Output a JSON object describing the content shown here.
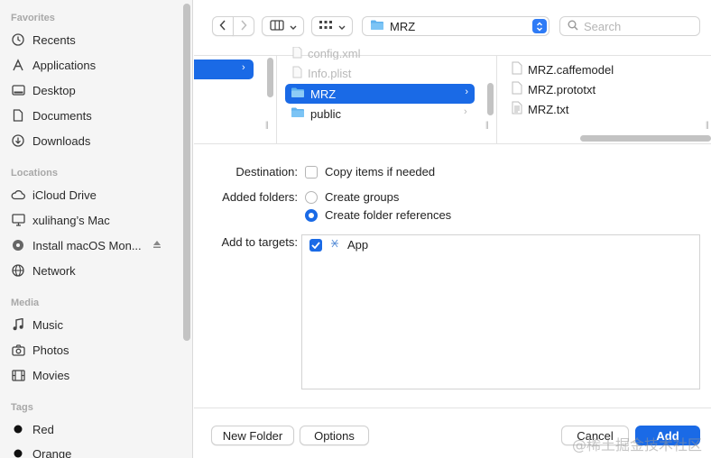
{
  "sidebar": {
    "favorites_header": "Favorites",
    "favorites": [
      {
        "label": "Recents",
        "icon": "clock-icon"
      },
      {
        "label": "Applications",
        "icon": "applications-icon"
      },
      {
        "label": "Desktop",
        "icon": "desktop-icon"
      },
      {
        "label": "Documents",
        "icon": "document-icon"
      },
      {
        "label": "Downloads",
        "icon": "download-icon"
      }
    ],
    "locations_header": "Locations",
    "locations": [
      {
        "label": "iCloud Drive",
        "icon": "cloud-icon"
      },
      {
        "label": "xulihang’s Mac",
        "icon": "computer-icon"
      },
      {
        "label": "Install macOS Mon...",
        "icon": "disk-icon"
      },
      {
        "label": "Network",
        "icon": "network-icon"
      }
    ],
    "media_header": "Media",
    "media": [
      {
        "label": "Music",
        "icon": "music-icon"
      },
      {
        "label": "Photos",
        "icon": "camera-icon"
      },
      {
        "label": "Movies",
        "icon": "film-icon"
      }
    ],
    "tags_header": "Tags",
    "tags": [
      {
        "label": "Red",
        "color": "#111111"
      },
      {
        "label": "Orange",
        "color": "#111111"
      }
    ]
  },
  "toolbar": {
    "path_value": "MRZ",
    "search_placeholder": "Search"
  },
  "browser": {
    "column2_items": [
      {
        "label": "config.xml",
        "faded": true
      },
      {
        "label": "Info.plist",
        "faded": true
      },
      {
        "label": "MRZ",
        "selected": true
      },
      {
        "label": "public"
      }
    ],
    "column3_items": [
      "MRZ.caffemodel",
      "MRZ.prototxt",
      "MRZ.txt"
    ]
  },
  "options": {
    "destination_label": "Destination:",
    "copy_items_label": "Copy items if needed",
    "copy_items_checked": false,
    "added_folders_label": "Added folders:",
    "create_groups_label": "Create groups",
    "create_folder_refs_label": "Create folder references",
    "selected_folder_option": "Create folder references",
    "add_to_targets_label": "Add to targets:",
    "targets": [
      {
        "label": "App",
        "checked": true
      }
    ]
  },
  "buttons": {
    "new_folder": "New Folder",
    "options": "Options",
    "cancel": "Cancel",
    "add": "Add"
  },
  "watermark": "@稀土掘金技术社区",
  "colors": {
    "accent": "#1a6ae6",
    "sidebar_bg": "#f5f5f5"
  }
}
